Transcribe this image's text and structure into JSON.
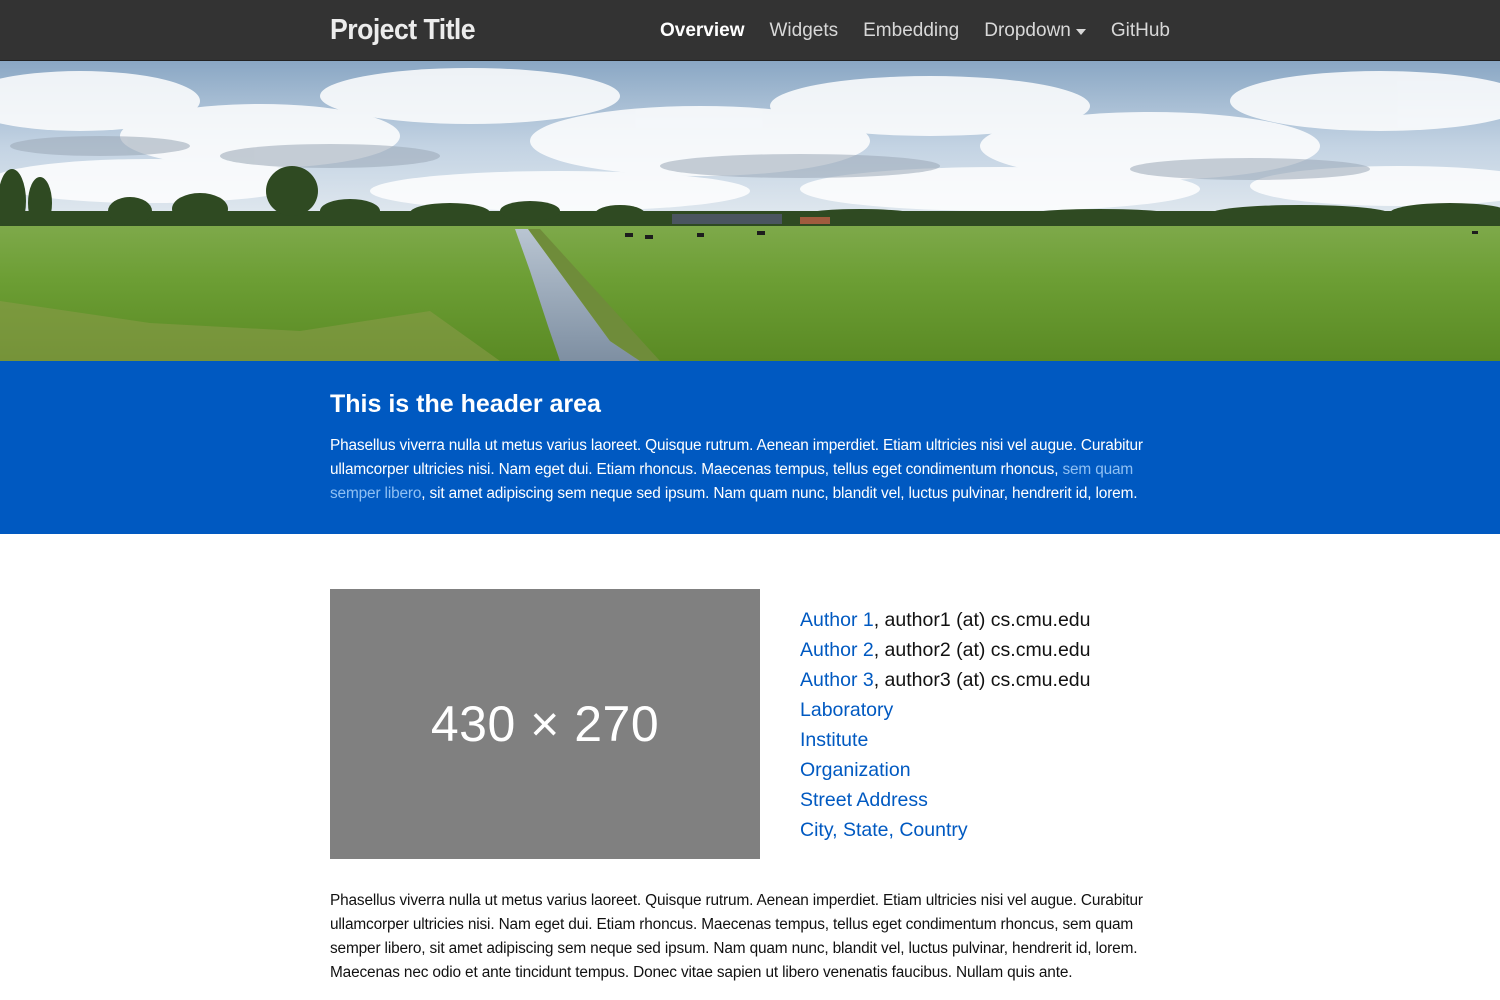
{
  "nav": {
    "brand": "Project Title",
    "items": [
      {
        "label": "Overview",
        "active": true
      },
      {
        "label": "Widgets",
        "active": false
      },
      {
        "label": "Embedding",
        "active": false
      },
      {
        "label": "Dropdown",
        "active": false,
        "dropdown": true
      },
      {
        "label": "GitHub",
        "active": false
      }
    ]
  },
  "hero": {
    "alt": "Panorama of a green polder with a drainage ditch under a cloudy sky"
  },
  "header": {
    "title": "This is the header area",
    "text_before": "Phasellus viverra nulla ut metus varius laoreet. Quisque rutrum. Aenean imperdiet. Etiam ultricies nisi vel augue. Curabitur ullamcorper ultricies nisi. Nam eget dui. Etiam rhoncus. Maecenas tempus, tellus eget condimentum rhoncus, ",
    "link_text": "sem quam semper libero",
    "text_after": ", sit amet adipiscing sem neque sed ipsum. Nam quam nunc, blandit vel, luctus pulvinar, hendrerit id, lorem."
  },
  "placeholder": {
    "label": "430 × 270"
  },
  "authors": [
    {
      "name": "Author 1",
      "email": ", author1 (at) cs.cmu.edu"
    },
    {
      "name": "Author 2",
      "email": ", author2 (at) cs.cmu.edu"
    },
    {
      "name": "Author 3",
      "email": ", author3 (at) cs.cmu.edu"
    }
  ],
  "affiliations": [
    "Laboratory",
    "Institute",
    "Organization",
    "Street Address",
    "City, State, Country"
  ],
  "body_text": "Phasellus viverra nulla ut metus varius laoreet. Quisque rutrum. Aenean imperdiet. Etiam ultricies nisi vel augue. Curabitur ullamcorper ultricies nisi. Nam eget dui. Etiam rhoncus. Maecenas tempus, tellus eget condimentum rhoncus, sem quam semper libero, sit amet adipiscing sem neque sed ipsum. Nam quam nunc, blandit vel, luctus pulvinar, hendrerit id, lorem. Maecenas nec odio et ante tincidunt tempus. Donec vitae sapien ut libero venenatis faucibus. Nullam quis ante.",
  "colors": {
    "navbar": "#333333",
    "header_band": "#0059c1",
    "link": "#0059c1",
    "header_link": "#8fc0f3",
    "placeholder": "#808080"
  }
}
